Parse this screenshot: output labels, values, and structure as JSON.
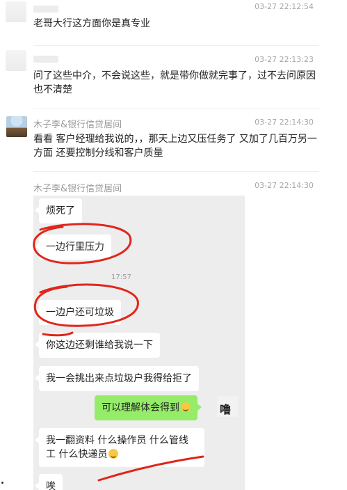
{
  "messages": [
    {
      "sender": "",
      "time": "03-27 22:12:54",
      "text": "老哥大行这方面你是真专业"
    },
    {
      "sender": "",
      "time": "03-27 22:13:23",
      "text": "问了这些中介，不会说这些，就是带你做就完事了，过不去问原因也不清楚"
    },
    {
      "sender": "木子李&银行信贷居间",
      "time": "03-27 22:14:30",
      "text": "看看 客户经理给我说的，，那天上边又压任务了 又加了几百万另一方面 还要控制分线和客户质量"
    },
    {
      "sender": "木子李&银行信贷居间",
      "time": "03-27 22:14:30",
      "text": ""
    }
  ],
  "screenshot": {
    "time_label": "17:57",
    "bubbles": [
      {
        "text": "烦死了",
        "side": "left"
      },
      {
        "text": "一边行里压力",
        "side": "left"
      },
      {
        "text": "一边户还可垃圾",
        "side": "left"
      },
      {
        "text": "你这边还剩谁给我说一下",
        "side": "left"
      },
      {
        "text": "我一会挑出来点垃圾户我得给拒了",
        "side": "left"
      },
      {
        "text": "可以理解体会得到",
        "side": "right"
      },
      {
        "text": "我一翻资料 什么操作员 什么管线工 什么快递员",
        "side": "left"
      },
      {
        "text": "唉",
        "side": "left"
      }
    ],
    "avatar_text": "噜"
  },
  "colors": {
    "annotation": "#e0261b",
    "green_bubble": "#95ec69"
  }
}
